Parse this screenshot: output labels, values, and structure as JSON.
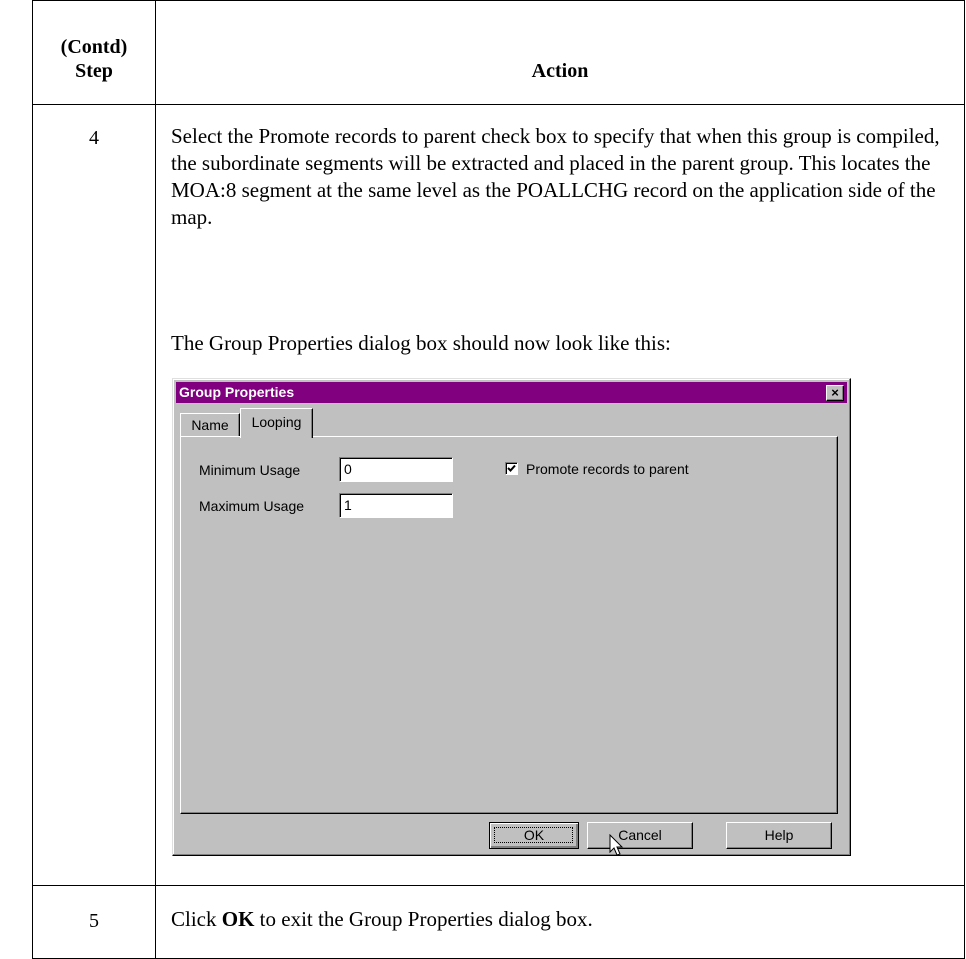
{
  "table": {
    "header_step": "(Contd)\nStep",
    "header_action": "Action"
  },
  "rows": [
    {
      "step": "4",
      "text": "Select the Promote records to parent check box to specify that when this group is compiled, the subordinate segments will be extracted and placed in the parent group. This locates the MOA:8 segment at the same level as the POALLCHG record on the application side of the map.",
      "caption": "The Group Properties dialog box should now look like this:"
    },
    {
      "step": "5",
      "text_before": "Click ",
      "text_bold": "OK",
      "text_after": " to exit the Group Properties dialog box."
    }
  ],
  "dialog": {
    "title": "Group Properties",
    "close_glyph": "×",
    "tabs": [
      {
        "label": "Name",
        "active": false
      },
      {
        "label": "Looping",
        "active": true
      }
    ],
    "min_usage_label": "Minimum Usage",
    "min_usage_value": "0",
    "max_usage_label": "Maximum Usage",
    "max_usage_value": "1",
    "promote_label": "Promote records to parent",
    "promote_checked": true,
    "buttons": {
      "ok": "OK",
      "cancel": "Cancel",
      "help": "Help"
    }
  },
  "colors": {
    "title_bar": "#800080",
    "dialog_face": "#c0c0c0"
  }
}
